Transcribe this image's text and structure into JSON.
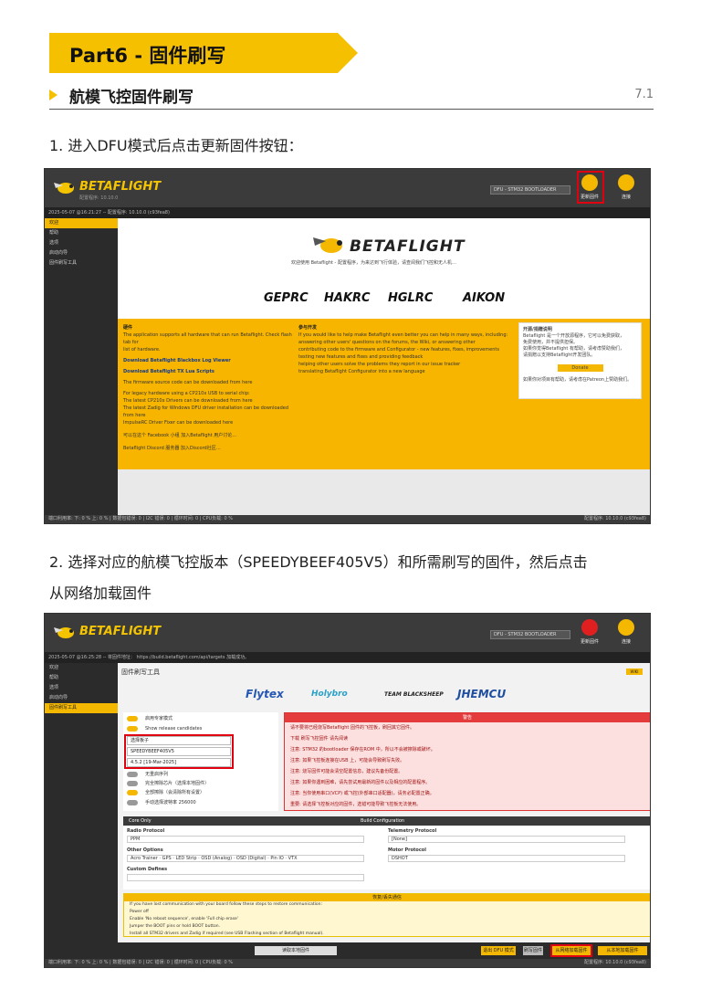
{
  "header": {
    "part_title": "Part6 - 固件刷写",
    "section_title": "航模飞控固件刷写",
    "page_number": "7.1"
  },
  "colors": {
    "accent": "#f5c000",
    "highlight": "#e00010"
  },
  "step1": {
    "text": "1. 进入DFU模式后点击更新固件按钮："
  },
  "step2": {
    "line1": "2. 选择对应的航模飞控版本（SPEEDYBEEF405V5）和所需刷写的固件，然后点击",
    "line2": "从网络加载固件"
  },
  "shot1": {
    "app_name": "BETAFLIGHT",
    "app_sub": "配置程序: 10.10.0",
    "status_line": "2025-05-07 @16:21:27 -- 配置程序: 10.10.0 (c93fea8)",
    "port_label": "DFU - STM32 BOOTLOADER",
    "update_btn_label": "更新固件",
    "connect_btn_label": "连接",
    "sidebar_items": [
      "欢迎",
      "帮助",
      "选项",
      "启动向导",
      "固件刷写工具"
    ],
    "hero_title": "BETAFLIGHT",
    "welcome_text": "欢迎使用 Betaflight - 配置程序，为来达到飞行体验，请查阅我们飞控和无人机…",
    "brands": [
      "GEPRC",
      "HAKRC",
      "HGLRC",
      "AIKON"
    ],
    "left_col_heading": "硬件",
    "left_col_lines": [
      "The application supports all hardware that can run Betaflight. Check flash tab for",
      "list of hardware.",
      "Download Betaflight Blackbox Log Viewer",
      "Download Betaflight TX Lua Scripts",
      "The firmware source code can be downloaded from here",
      "For legacy hardware using a CP210x USB to serial chip:",
      "The latest CP210x Drivers can be downloaded from here",
      "The latest Zadig for Windows DFU driver installation can be downloaded from here",
      "ImpulseRC Driver Fixer can be downloaded here"
    ],
    "facebook_text": "可以在这个 Facebook 小组 加入Betaflight 用户讨论…",
    "discord_text": "Betaflight Discord 服务器 加入Discord社区…",
    "mid_col_heading": "参与开发",
    "mid_col_lines": [
      "If you would like to help make Betaflight even better you can help in many ways, including:",
      "answering other users' questions on the forums, the Wiki, or answering other",
      "contributing code to the firmware and Configurator - new features, fixes, improvements",
      "testing new features and fixes and providing feedback",
      "helping other users solve the problems they report in our issue tracker",
      "translating Betaflight Configurator into a new language"
    ],
    "card_title": "开源/捐赠说明",
    "card_lines": [
      "Betaflight 是一个开放源程序，它可以免费获取，",
      "免费使用，并不提供担保。",
      "如果你觉得Betaflight 有帮助，请考虑赞助我们，",
      "请捐赠以支持Betaflight开发团队。"
    ],
    "card_button": "Donate",
    "card_footer": "如果你对项目有帮助，请考虑在Patreon上赞助我们。",
    "bottom_status": "端口利用率: 下: 0 % 上: 0 % | 数据包错误: 0 | I2C 错误: 0 | 循环时间: 0 | CPU负载: 0 %",
    "bottom_version": "配置程序: 10.10.0 (c93fea8)"
  },
  "shot2": {
    "app_name": "BETAFLIGHT",
    "status_line": "2025-05-07 @16:25:28 -- 将固件地址： https://build.betaflight.com/api/targets 加载成功。",
    "port_label": "DFU - STM32 BOOTLOADER",
    "update_btn_label": "更新固件",
    "connect_btn_label": "连接",
    "sidebar_items": [
      "欢迎",
      "帮助",
      "选项",
      "启动向导",
      "固件刷写工具"
    ],
    "tool_title": "固件刷写工具",
    "wiki_label": "WIKI",
    "brands": [
      "Flytex",
      "Holybro",
      "TEAM BLACKSHEEP",
      "JHEMCU"
    ],
    "option_rows": [
      "启用专家模式",
      "Show release candidates",
      "无重启序列",
      "完全擦除芯片（选择本地固件）",
      "全部擦除（会清除所有设置）",
      "手动选择波特率"
    ],
    "select_target_label": "选择板子",
    "select_board": "SPEEDYBEEF405V5",
    "select_version": "4.5.2 [19-Mar-2025]",
    "baud_value": "256000",
    "warn_title": "警告",
    "warn_lines": [
      "请不要将已经烧写Betaflight 固件的飞控板，刷回其它固件。",
      "下载 刷写飞控固件 请先阅读",
      "注意: STM32 的bootloader 保存在ROM 中，所以不会被擦除或破坏。",
      "注意: 如果飞控板连接在USB 上，可能会导致刷写失败。",
      "注意: 烧写固件可能会清空配置信息，建议先备份配置。",
      "注意: 如果你遇到困难，请先尝试用最新的固件以及相应的配置程序。",
      "注意: 当你使用串口(VCP) 或飞控(外部串口适配器)，请务必配置正确。",
      "重要: 请选择飞控板对应的固件，选错可能导致飞控板无法使用。"
    ],
    "core_only_label": "Core Only",
    "build_config_label": "Build Configuration",
    "radio_protocol_label": "Radio Protocol",
    "radio_protocol_value": "PPM",
    "telemetry_label": "Telemetry Protocol",
    "telemetry_value": "[None]",
    "other_options_label": "Other Options",
    "other_options_chips": [
      "Acro Trainer",
      "GPS",
      "LED Strip",
      "OSD (Analog)",
      "OSD (Digital)",
      "Pin IO",
      "VTX"
    ],
    "motor_protocol_label": "Motor Protocol",
    "motor_protocol_value": "DSHOT",
    "custom_defines_label": "Custom Defines",
    "recover_title": "恢复/丢失通信",
    "recover_lines": [
      "If you have lost communication with your board follow these steps to restore communication:",
      "Power off",
      "Enable 'No reboot sequence', enable 'Full chip erase'",
      "Jumper the BOOT pins or hold BOOT button.",
      "Power on (activity LED will NOT flash if done correctly).",
      "Install all STM32 drivers and Zadig if required (see USB Flashing section of Betaflight manual)."
    ],
    "btn_load_local": "读取本地固件",
    "btn_dfu_exit": "退出 DFU 模式",
    "btn_flash": "刷写固件",
    "btn_load_online": "从网络加载固件",
    "btn_load_online_alt": "从本地加载固件",
    "bottom_status": "端口利用率: 下: 0 % 上: 0 % | 数据包错误: 0 | I2C 错误: 0 | 循环时间: 0 | CPU负载: 0 %",
    "bottom_version": "配置程序: 10.10.0 (c93fea8)"
  }
}
